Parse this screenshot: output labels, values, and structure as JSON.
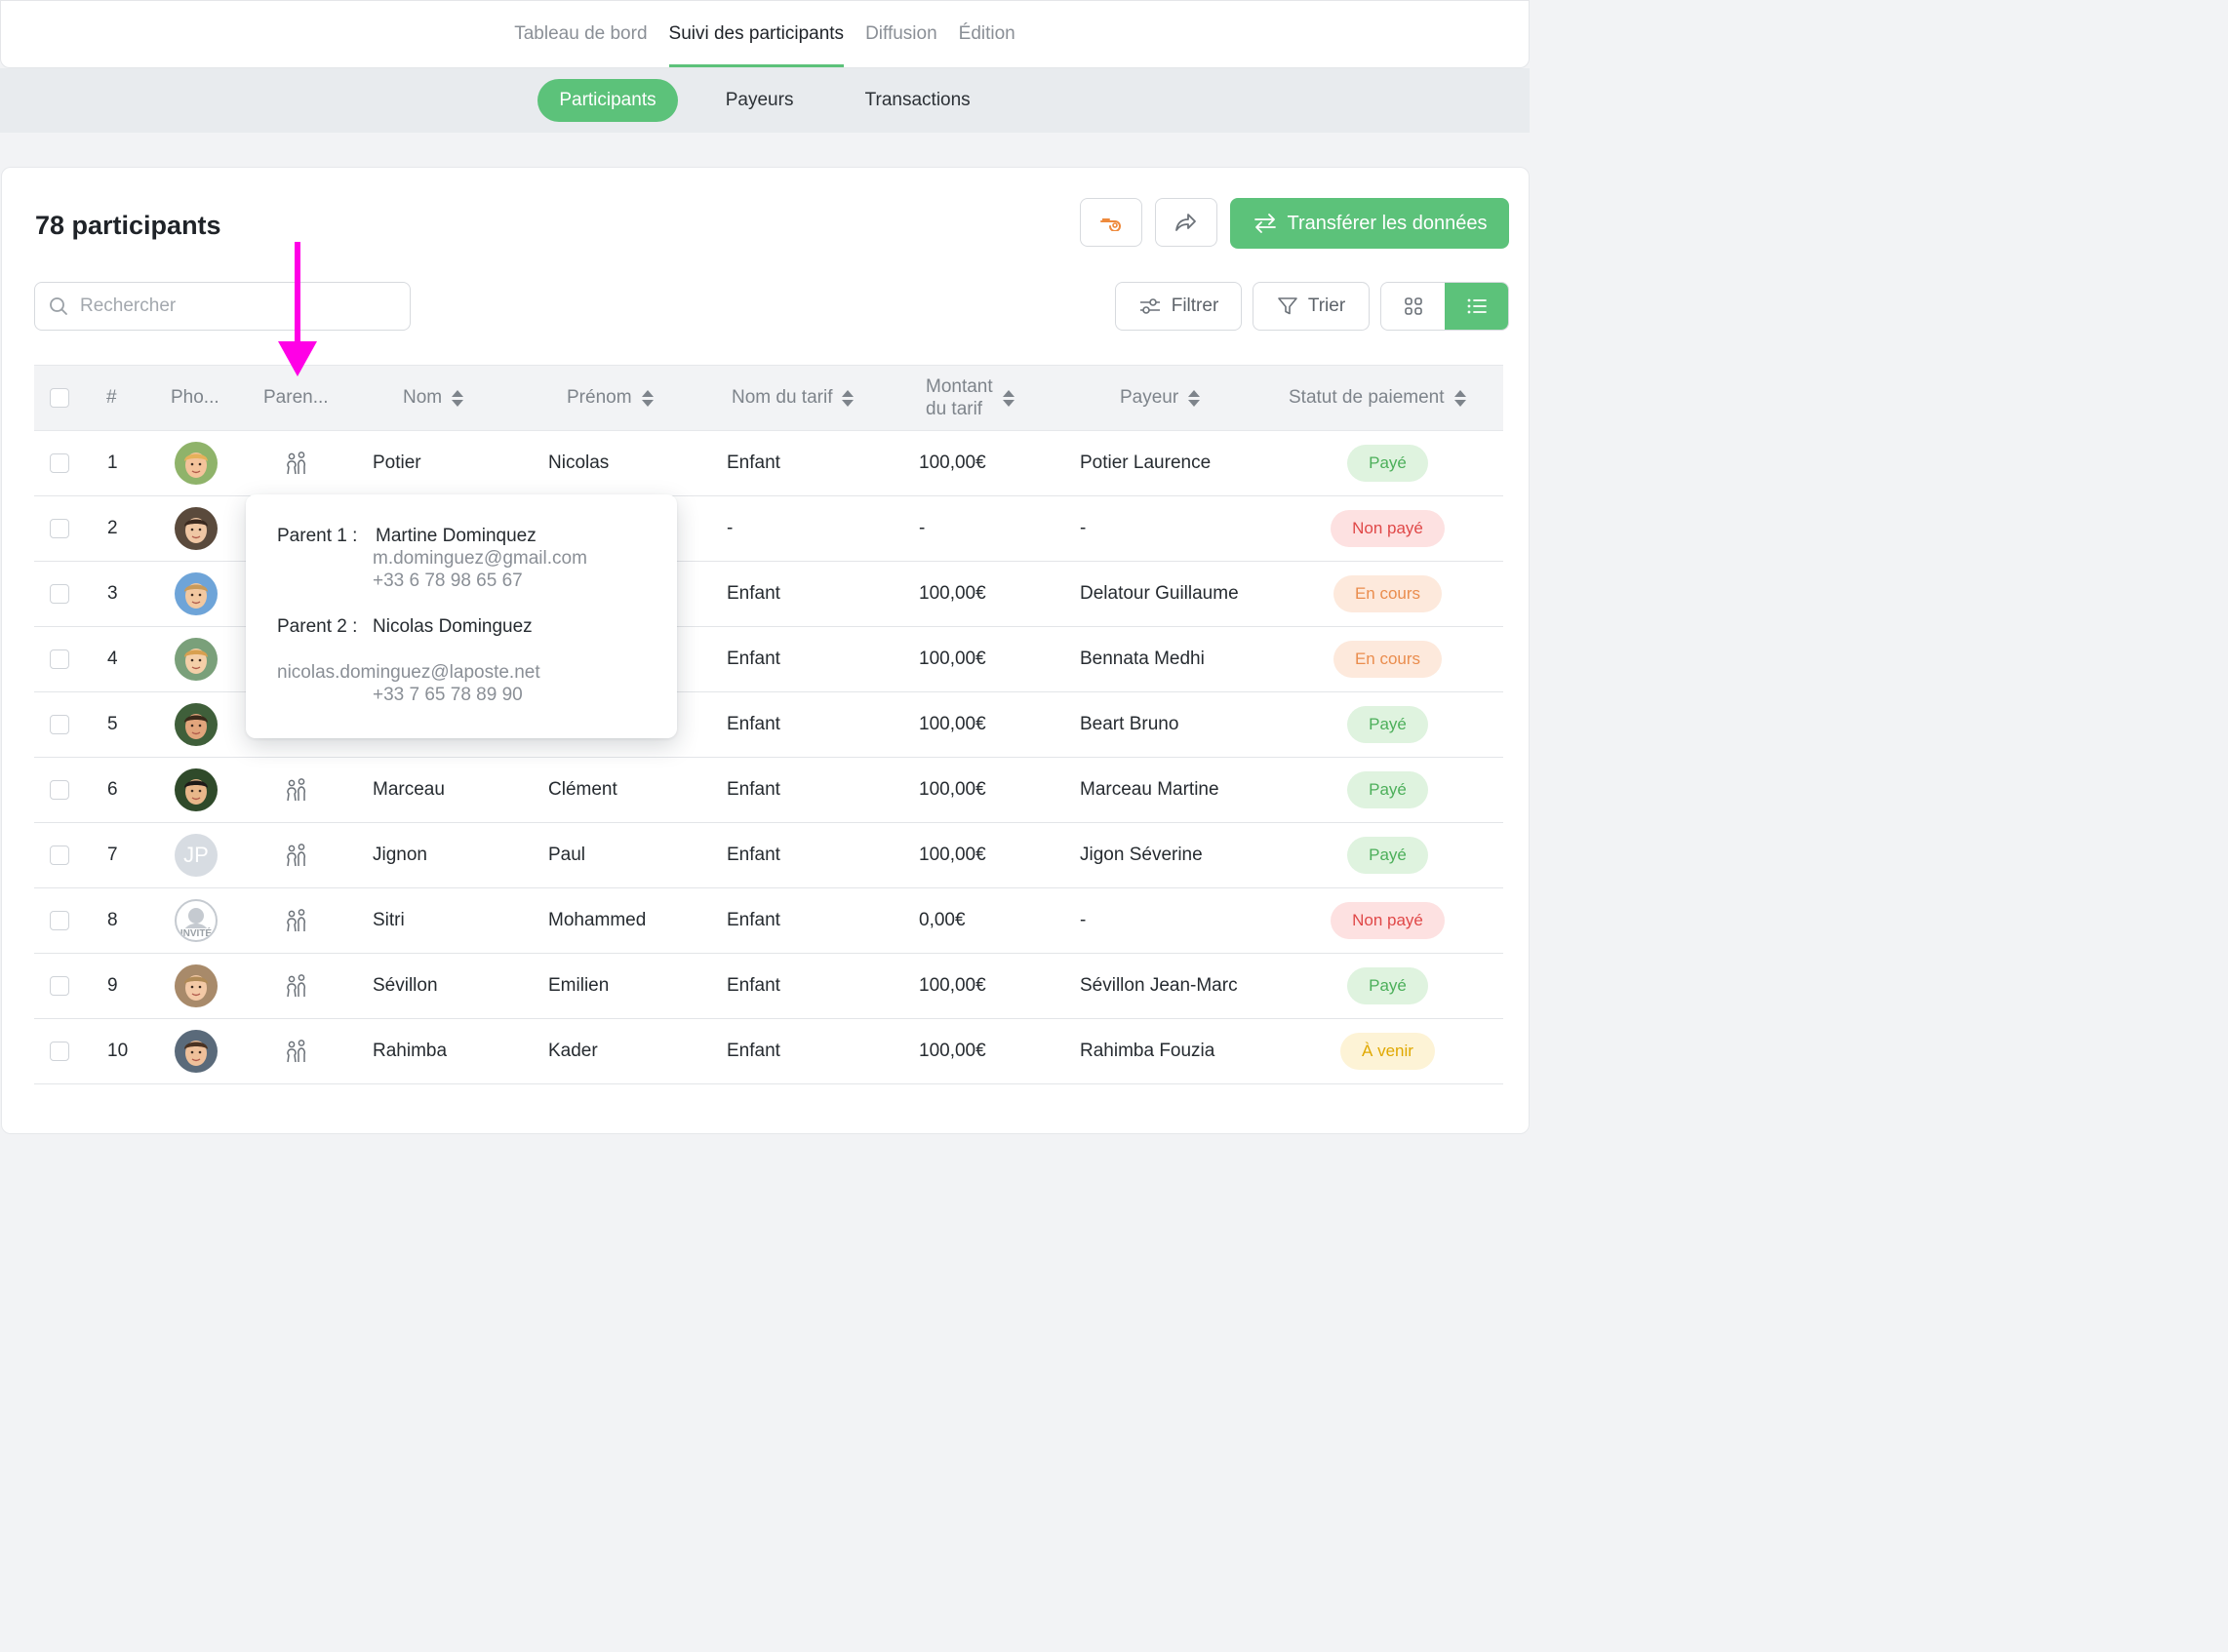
{
  "topnav": {
    "tabs": [
      {
        "label": "Tableau de bord"
      },
      {
        "label": "Suivi des participants"
      },
      {
        "label": "Diffusion"
      },
      {
        "label": "Édition"
      }
    ]
  },
  "subnav": {
    "tabs": [
      {
        "label": "Participants"
      },
      {
        "label": "Payeurs"
      },
      {
        "label": "Transactions"
      }
    ]
  },
  "header": {
    "title": "78 participants",
    "transfer_label": "Transférer les données"
  },
  "toolbar": {
    "search_placeholder": "Rechercher",
    "filter_label": "Filtrer",
    "sort_label": "Trier"
  },
  "table": {
    "columns": {
      "num": "#",
      "photo": "Pho...",
      "parents": "Paren...",
      "nom": "Nom",
      "prenom": "Prénom",
      "tarif": "Nom du tarif",
      "montant_l1": "Montant",
      "montant_l2": "du tarif",
      "payeur": "Payeur",
      "statut": "Statut de paiement"
    },
    "rows": [
      {
        "num": "1",
        "nom": "Potier",
        "prenom": "Nicolas",
        "tarif": "Enfant",
        "montant": "100,00€",
        "payeur": "Potier Laurence",
        "statut": "Payé"
      },
      {
        "num": "2",
        "nom": "",
        "prenom": "",
        "tarif": "-",
        "montant": "-",
        "payeur": "-",
        "statut": "Non payé"
      },
      {
        "num": "3",
        "nom": "",
        "prenom": "",
        "tarif": "Enfant",
        "montant": "100,00€",
        "payeur": "Delatour Guillaume",
        "statut": "En cours"
      },
      {
        "num": "4",
        "nom": "",
        "prenom": "",
        "tarif": "Enfant",
        "montant": "100,00€",
        "payeur": "Bennata Medhi",
        "statut": "En cours"
      },
      {
        "num": "5",
        "nom": "",
        "prenom": "",
        "tarif": "Enfant",
        "montant": "100,00€",
        "payeur": "Beart Bruno",
        "statut": "Payé"
      },
      {
        "num": "6",
        "nom": "Marceau",
        "prenom": "Clément",
        "tarif": "Enfant",
        "montant": "100,00€",
        "payeur": "Marceau Martine",
        "statut": "Payé"
      },
      {
        "num": "7",
        "nom": "Jignon",
        "prenom": "Paul",
        "tarif": "Enfant",
        "montant": "100,00€",
        "payeur": "Jigon Séverine",
        "statut": "Payé",
        "initials": "JP"
      },
      {
        "num": "8",
        "nom": "Sitri",
        "prenom": "Mohammed",
        "tarif": "Enfant",
        "montant": "0,00€",
        "payeur": "-",
        "statut": "Non payé",
        "guest": "INVITÉ"
      },
      {
        "num": "9",
        "nom": "Sévillon",
        "prenom": "Emilien",
        "tarif": "Enfant",
        "montant": "100,00€",
        "payeur": "Sévillon Jean-Marc",
        "statut": "Payé"
      },
      {
        "num": "10",
        "nom": "Rahimba",
        "prenom": "Kader",
        "tarif": "Enfant",
        "montant": "100,00€",
        "payeur": "Rahimba Fouzia",
        "statut": "À venir"
      }
    ]
  },
  "popup": {
    "p1_label": "Parent 1 :",
    "p1_name": "Martine Dominquez",
    "p1_email": "m.dominguez@gmail.com",
    "p1_phone": "+33 6 78 98 65 67",
    "p2_label": "Parent 2 :",
    "p2_name": "Nicolas Dominguez",
    "p2_email": "nicolas.dominguez@laposte.net",
    "p2_phone": "+33 7 65 78 89 90"
  },
  "colors": {
    "accent": "#5cc27a",
    "arrow": "#ff00e6",
    "paid": "#4caf5a",
    "unpaid": "#e04848",
    "in_progress": "#ea8d4e",
    "upcoming": "#e0a800"
  },
  "icons": [
    "whistle-icon",
    "share-icon",
    "transfer-icon",
    "search-icon",
    "filter-sliders-icon",
    "funnel-icon",
    "grid-view-icon",
    "list-view-icon",
    "parents-icon"
  ]
}
